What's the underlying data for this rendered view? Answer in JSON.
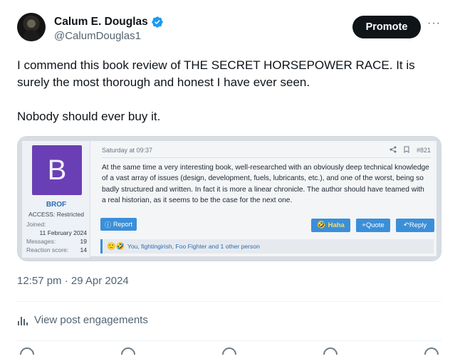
{
  "author": {
    "display_name": "Calum E. Douglas",
    "handle": "@CalumDouglas1",
    "verified_icon": "verified-badge-icon"
  },
  "header": {
    "promote_label": "Promote",
    "more_label": "···"
  },
  "tweet": {
    "line1": "I commend this book review of THE SECRET HORSEPOWER RACE. It is surely the most thorough and honest I have ever seen.",
    "line2": "Nobody should ever buy it."
  },
  "embed": {
    "user": {
      "avatar_letter": "B",
      "avatar_color": "#6a3fb5",
      "username": "BROF",
      "access": "ACCESS: Restricted",
      "joined_label": "Joined:",
      "joined_value": "11 February 2024",
      "messages_label": "Messages:",
      "messages_value": "19",
      "reaction_label": "Reaction score:",
      "reaction_value": "14"
    },
    "post": {
      "date": "Saturday at 09:37",
      "post_number": "#821",
      "body": "At the same time a very interesting book, well-researched with an obviously deep technical knowledge of a vast array of issues (design, development, fuels, lubricants, etc.), and one of the worst, being so badly structured and written. In fact it is more a linear chronicle. The author should have teamed with a real historian, as it seems to be the case for the next one.",
      "report_label": "Report",
      "haha_label": "Haha",
      "quote_label": "Quote",
      "reply_label": "Reply",
      "reactions_emoji": "🙁🤣",
      "reactions_text": "You, fightingirish, Foo Fighter and 1 other person"
    }
  },
  "timestamp": "12:57 pm · 29 Apr 2024",
  "engagements_label": "View post engagements",
  "accent_color": "#3b8fd8"
}
